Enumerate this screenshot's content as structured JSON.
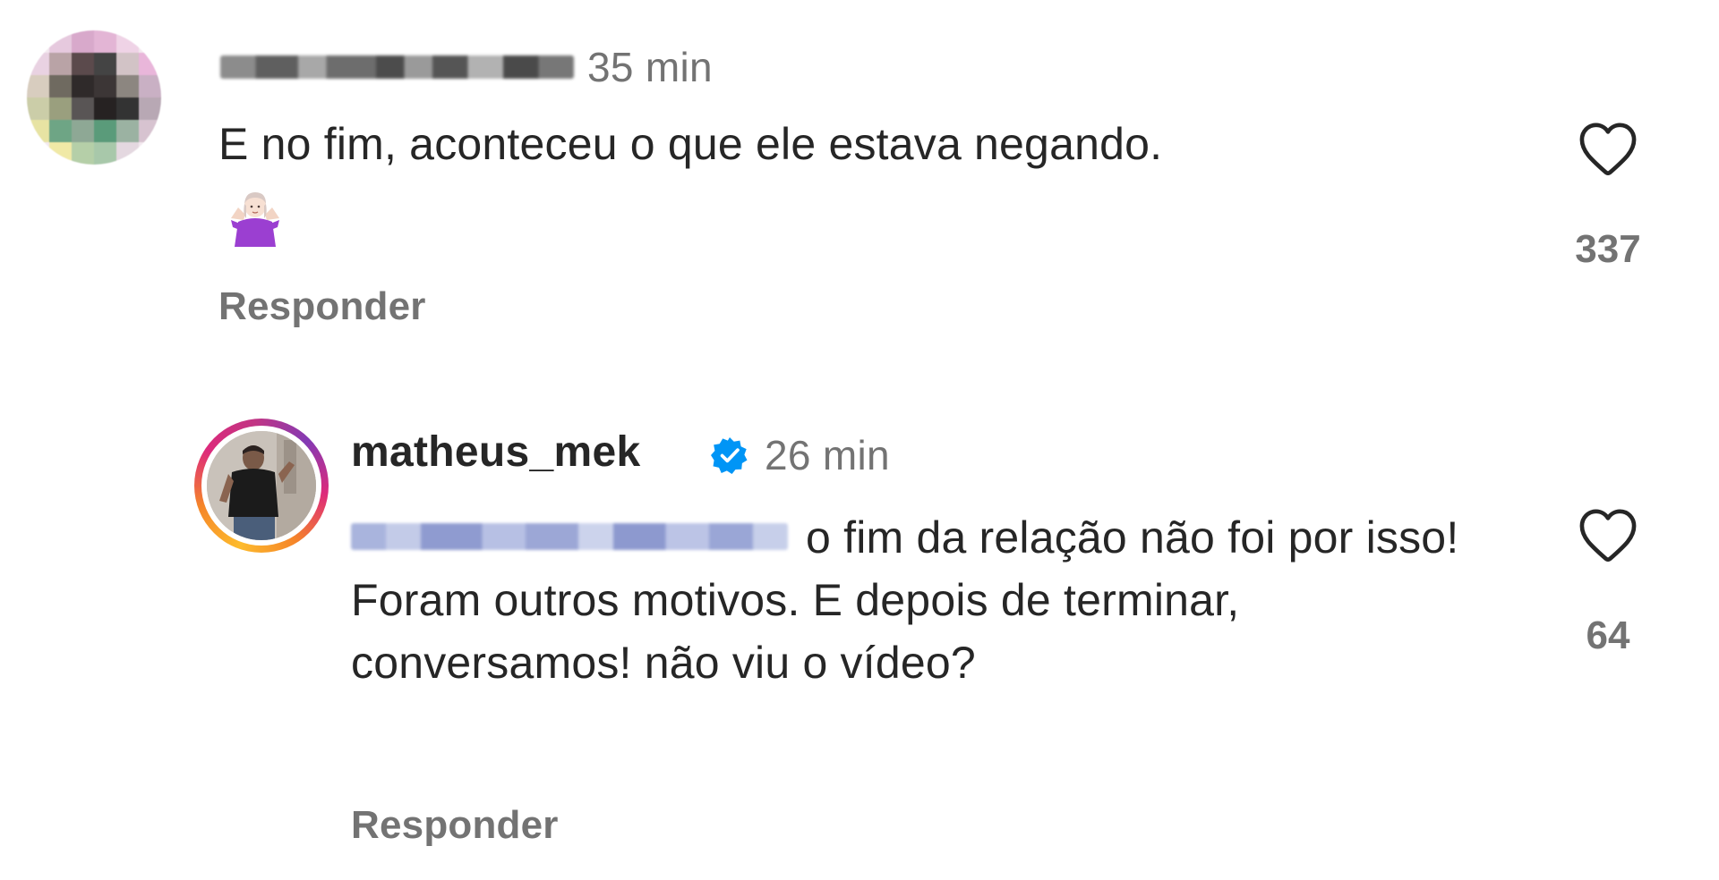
{
  "comments": [
    {
      "username": "",
      "timestamp": "35 min",
      "text": "E no fim, aconteceu o que ele estava negando.",
      "emoji": "person-shrugging-emoji",
      "reply_label": "Responder",
      "like_icon": "heart-outline-icon",
      "like_count": "337"
    },
    {
      "username": "matheus_mek",
      "verified_icon": "verified-badge-icon",
      "timestamp": "26 min",
      "mention": "",
      "text": "o fim da relação não foi por isso! Foram outros motivos. E depois de terminar, conversamos! não viu o vídeo?",
      "reply_label": "Responder",
      "like_icon": "heart-outline-icon",
      "like_count": "64"
    }
  ],
  "colors": {
    "text_primary": "#262626",
    "text_secondary": "#737373",
    "verified_blue": "#0095f6",
    "story_ring": [
      "#fdbb2d",
      "#f58529",
      "#dd2a7b",
      "#833ab4"
    ]
  }
}
